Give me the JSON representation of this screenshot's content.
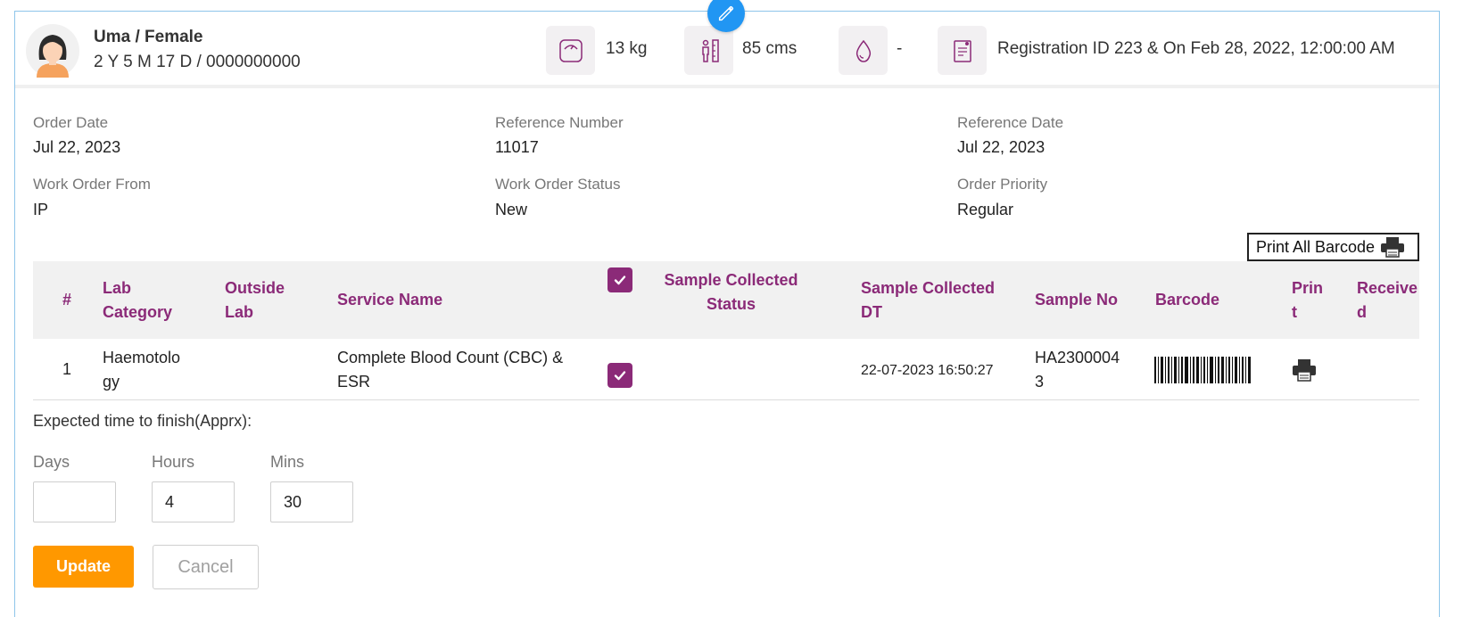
{
  "patient": {
    "name_gender": "Uma / Female",
    "age_mrn": "2 Y 5 M 17 D / 0000000000",
    "weight": "13 kg",
    "height": "85 cms",
    "blood_group": "-",
    "registration": "Registration ID 223 & On Feb 28, 2022, 12:00:00 AM"
  },
  "order": {
    "order_date_label": "Order Date",
    "order_date": "Jul 22, 2023",
    "ref_number_label": "Reference Number",
    "ref_number": "11017",
    "ref_date_label": "Reference Date",
    "ref_date": "Jul 22, 2023",
    "work_order_from_label": "Work Order From",
    "work_order_from": "IP",
    "work_order_status_label": "Work Order Status",
    "work_order_status": "New",
    "order_priority_label": "Order Priority",
    "order_priority": "Regular"
  },
  "print_all_label": "Print All Barcode",
  "table": {
    "headers": {
      "index": "#",
      "lab_category_1": "Lab",
      "lab_category_2": "Category",
      "outside_lab_1": "Outside",
      "outside_lab_2": "Lab",
      "service_name": "Service Name",
      "sample_status_1": "Sample Collected",
      "sample_status_2": "Status",
      "sample_dt_1": "Sample Collected",
      "sample_dt_2": "DT",
      "sample_no": "Sample No",
      "barcode": "Barcode",
      "print_1": "Prin",
      "print_2": "t",
      "received_1": "Receive",
      "received_2": "d"
    },
    "rows": [
      {
        "index": "1",
        "lab_category_1": "Haemotolo",
        "lab_category_2": "gy",
        "service_name_1": "Complete Blood Count (CBC) &",
        "service_name_2": "ESR",
        "sample_dt": "22-07-2023 16:50:27",
        "sample_no_1": "HA2300004",
        "sample_no_2": "3"
      }
    ]
  },
  "expected": {
    "label": "Expected time to finish(Apprx):",
    "days_label": "Days",
    "days_value": "",
    "hours_label": "Hours",
    "hours_value": "4",
    "mins_label": "Mins",
    "mins_value": "30"
  },
  "buttons": {
    "update": "Update",
    "cancel": "Cancel"
  },
  "colors": {
    "accent": "#8b2a78",
    "primary_button": "#ff9800",
    "edit_button": "#2196f3"
  }
}
